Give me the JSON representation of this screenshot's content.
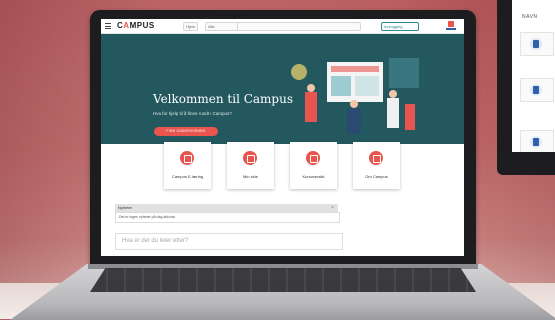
{
  "screen": {
    "logo_pre": "C",
    "logo_accent": "A",
    "logo_post": "MPUS",
    "nav_pill_1": "Hjem",
    "nav_pill_2": "Alle",
    "login_button": "Innlogging",
    "hero": {
      "title": "Velkommen til Campus",
      "subtitle": "Hva for hjelp til å finne rundt i Campus?",
      "cta": "FINN UNDERVISNING"
    },
    "cards": [
      {
        "label": "Campus E-læring",
        "icon": "laptop-icon"
      },
      {
        "label": "Min side",
        "icon": "user-icon"
      },
      {
        "label": "Kursoversikt",
        "icon": "list-icon"
      },
      {
        "label": "Om Campus",
        "icon": "info-icon"
      }
    ],
    "panel": {
      "title": "Nyheter",
      "row": "Det er ingen nyheter på dag akkurat",
      "ask_placeholder": "Hva er det du leter etter?"
    }
  },
  "monitor": {
    "title": "NAVN"
  },
  "colors": {
    "accent": "#e8554e",
    "hero_bg": "#24585f",
    "wall": "#c46d6d"
  }
}
